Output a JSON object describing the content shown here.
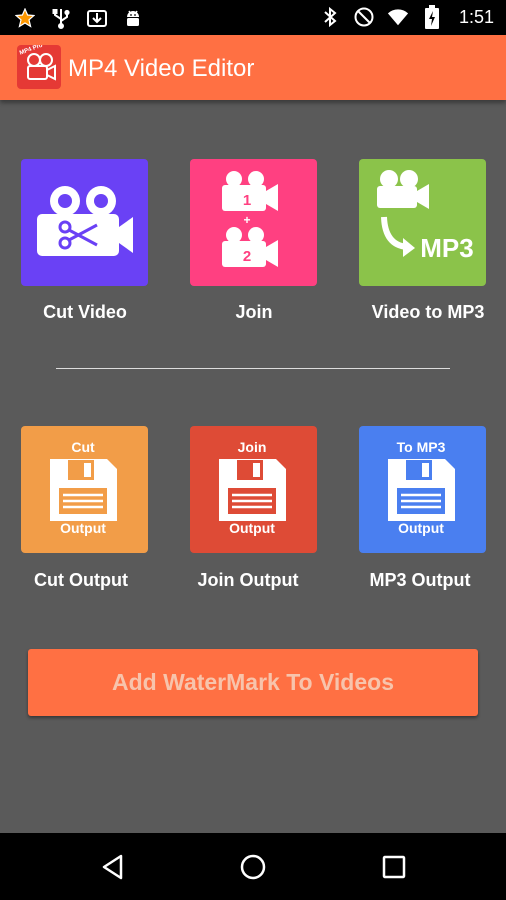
{
  "status_bar": {
    "time": "1:51"
  },
  "app_bar": {
    "title": "MP4 Video Editor",
    "logo_text": "MP4 Pro"
  },
  "actions_top": [
    {
      "label": "Cut Video",
      "color": "#6a41f5",
      "icon": "video-scissors-icon"
    },
    {
      "label": "Join",
      "color": "#ff4081",
      "icon": "join-videos-icon",
      "icon_text": [
        "1",
        "+",
        "2"
      ]
    },
    {
      "label": "Video to MP3",
      "color": "#8bc34a",
      "icon": "video-to-mp3-icon",
      "icon_text": "MP3"
    }
  ],
  "actions_bottom": [
    {
      "label": "Cut Output",
      "color": "#f29d48",
      "icon": "save-icon",
      "icon_top": "Cut",
      "icon_bottom": "Output"
    },
    {
      "label": "Join Output",
      "color": "#de4b36",
      "icon": "save-icon",
      "icon_top": "Join",
      "icon_bottom": "Output"
    },
    {
      "label": "MP3 Output",
      "color": "#4a7ff0",
      "icon": "save-icon",
      "icon_top": "To MP3",
      "icon_bottom": "Output"
    }
  ],
  "watermark_button": {
    "label": "Add WaterMark To Videos"
  },
  "nav": {
    "back": "back-icon",
    "home": "home-icon",
    "recents": "recents-icon"
  }
}
